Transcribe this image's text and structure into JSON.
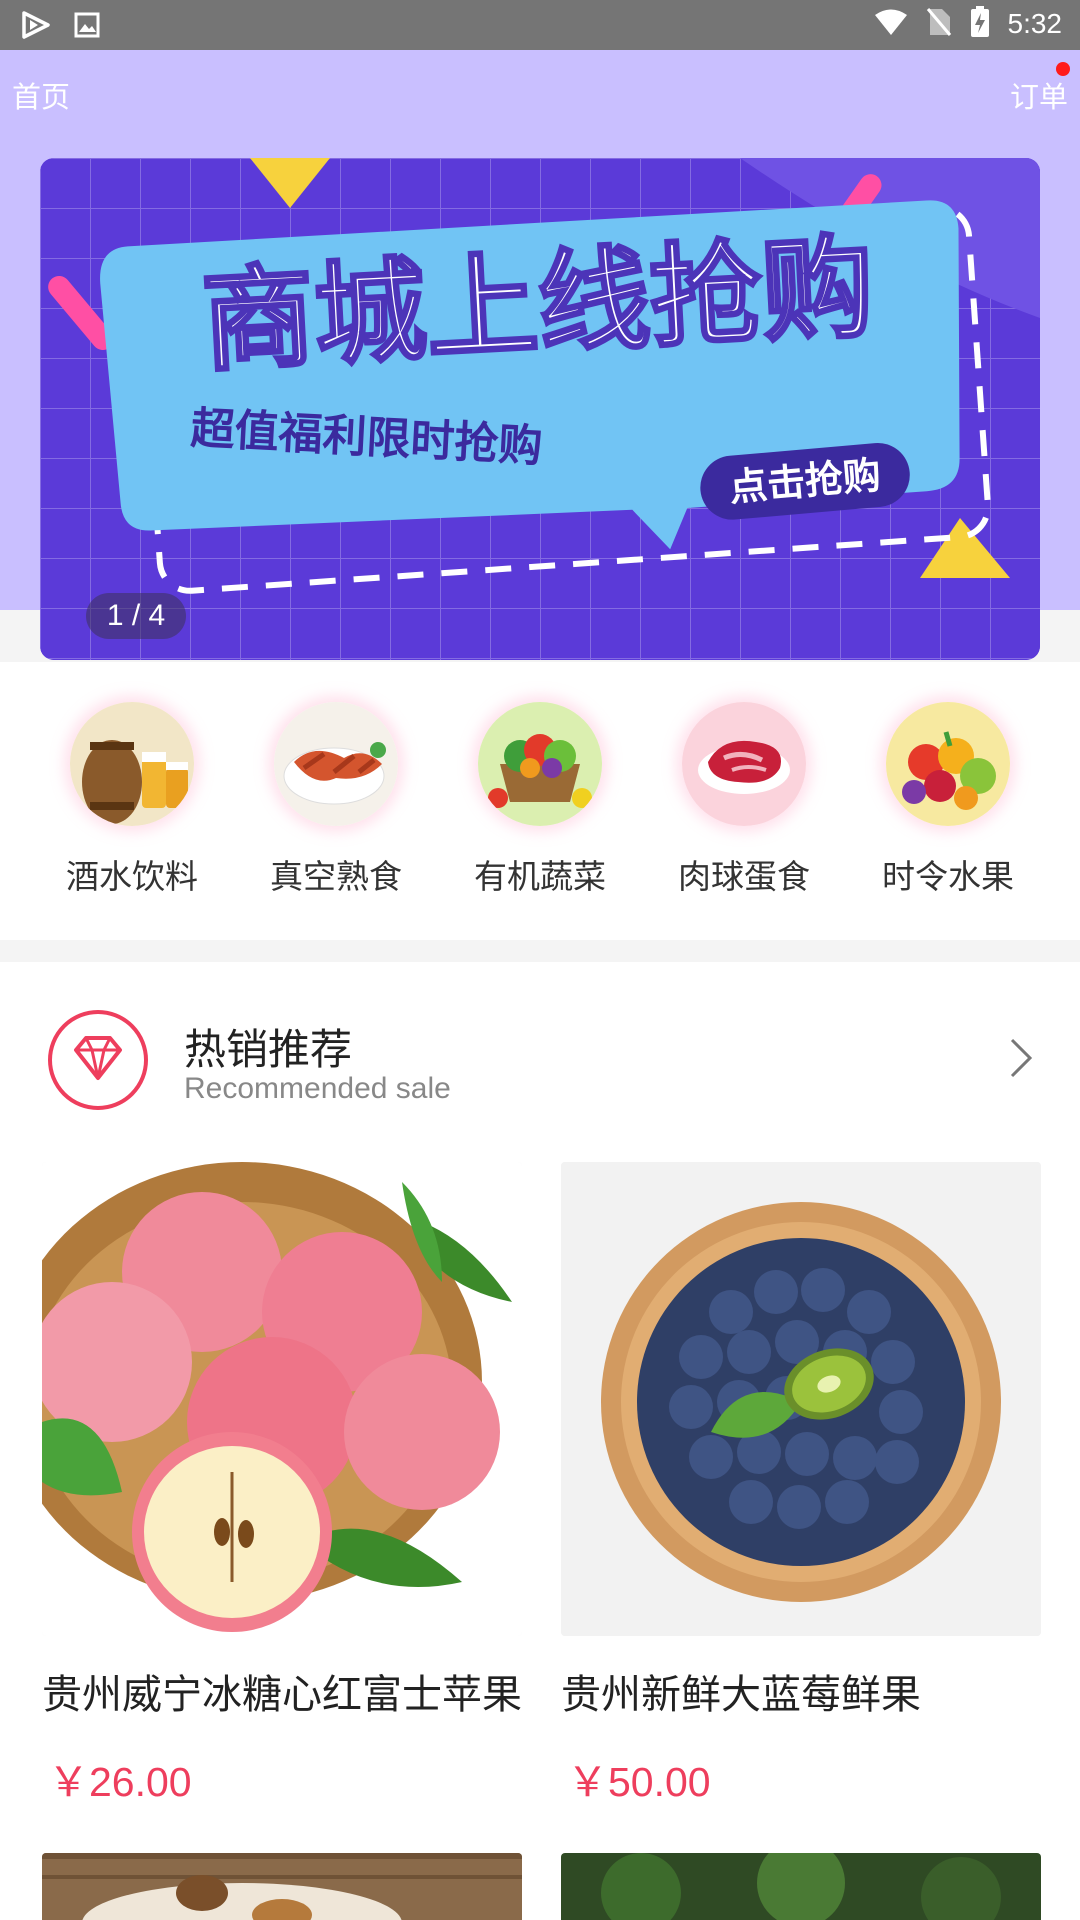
{
  "status_bar": {
    "time": "5:32",
    "icons": [
      "play-store-icon",
      "image-icon",
      "wifi-icon",
      "no-sim-icon",
      "battery-charging-icon"
    ]
  },
  "header": {
    "home_label": "首页",
    "order_label": "订单"
  },
  "banner": {
    "title": "商城上线抢购",
    "subtitle": "超值福利限时抢购",
    "cta": "点击抢购",
    "indicator": "1 / 4"
  },
  "categories": [
    {
      "label": "酒水饮料",
      "icon": "drinks-image"
    },
    {
      "label": "真空熟食",
      "icon": "cooked-food-image"
    },
    {
      "label": "有机蔬菜",
      "icon": "vegetables-image"
    },
    {
      "label": "肉球蛋食",
      "icon": "meat-image"
    },
    {
      "label": "时令水果",
      "icon": "fruits-image"
    }
  ],
  "section": {
    "title": "热销推荐",
    "subtitle": "Recommended sale"
  },
  "products": [
    {
      "name": "贵州威宁冰糖心红富士苹果",
      "price": "￥26.00"
    },
    {
      "name": "贵州新鲜大蓝莓鲜果 ",
      "price": "￥50.00"
    }
  ],
  "colors": {
    "header_bg": "#c9bfff",
    "price": "#ee3e5d",
    "accent": "#ee3e5d"
  }
}
